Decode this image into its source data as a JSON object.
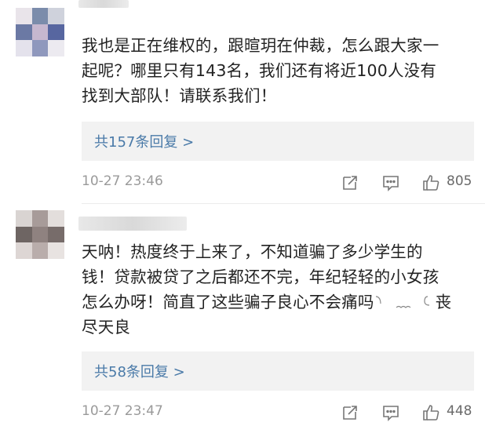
{
  "comments": [
    {
      "text_lines": [
        "我也是正在维权的，跟暄玥在仲裁，怎么跟大家一",
        "起呢？哪里只有143名，我们还有将近100人没有",
        "找到大部队！请联系我们！"
      ],
      "replies_label": "共157条回复 >",
      "time": "10-27 23:46",
      "likes": "805"
    },
    {
      "text_lines": [
        "天呐！热度终于上来了，不知道骗了多少学生的",
        "钱！贷款被贷了之后都还不完，年纪轻轻的小女孩",
        "怎么办呀！简直了这些骗子良心不会痛吗",
        "尽天良"
      ],
      "emoji_label": "丧",
      "replies_label": "共58条回复 >",
      "time": "10-27 23:47",
      "likes": "448"
    }
  ],
  "icons": {
    "share": "edit-share-icon",
    "comment": "comment-icon",
    "like": "thumbs-up-icon"
  },
  "colors": {
    "link": "#4a7aa8",
    "muted": "#9a9a9a",
    "reply_bg": "#f2f2f2"
  }
}
